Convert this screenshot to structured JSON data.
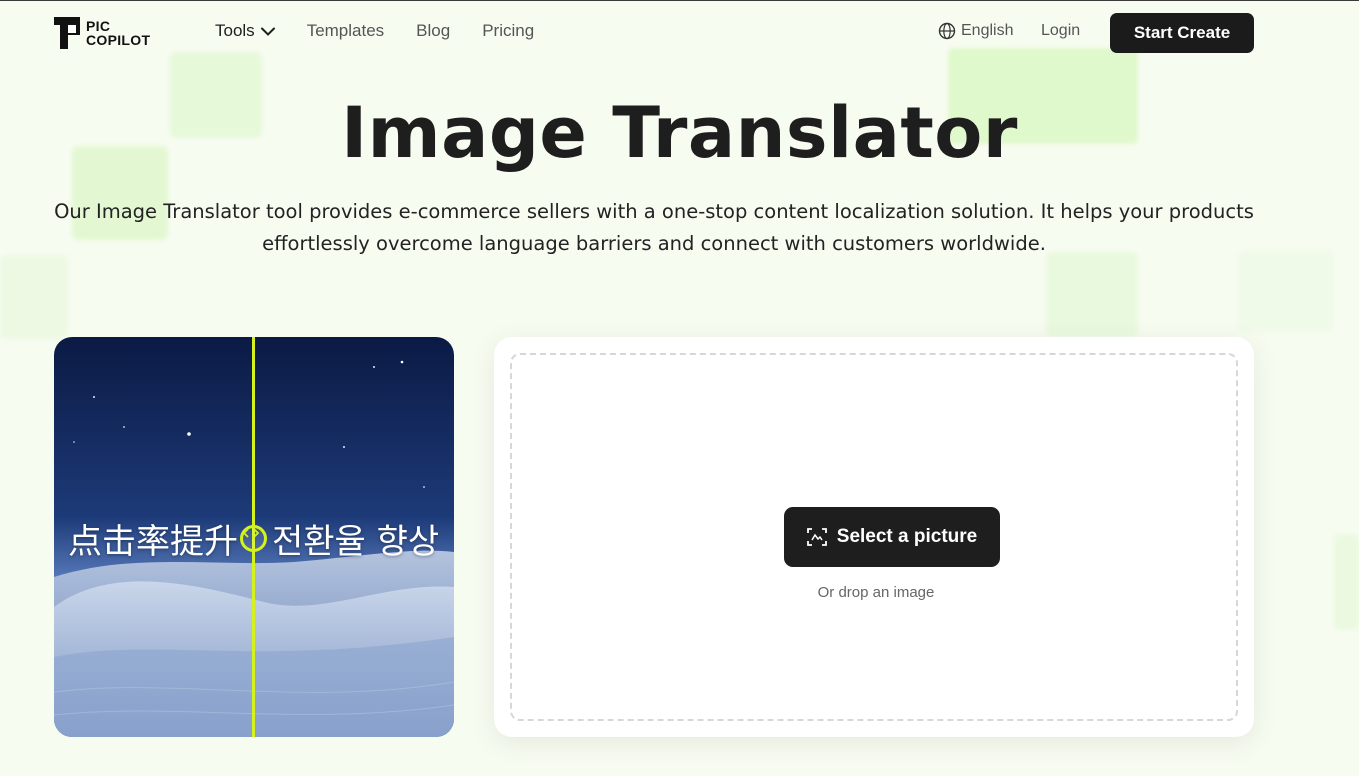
{
  "header": {
    "logo": {
      "line1": "PIC",
      "line2": "COPILOT"
    },
    "nav": [
      {
        "label": "Tools",
        "has_dropdown": true
      },
      {
        "label": "Templates"
      },
      {
        "label": "Blog"
      },
      {
        "label": "Pricing"
      }
    ],
    "language": "English",
    "login": "Login",
    "start_button": "Start Create"
  },
  "hero": {
    "title": "Image Translator",
    "subtitle": "Our Image Translator tool provides e-commerce sellers with a one-stop content localization solution. It helps your products effortlessly overcome language barriers and connect with customers worldwide."
  },
  "preview": {
    "original_text": "点击率提升",
    "translated_text": "전환율 향상"
  },
  "upload": {
    "button_label": "Select a picture",
    "drop_hint": "Or drop an image"
  },
  "colors": {
    "accent": "#d6f21d",
    "button_dark": "#1b1b1b",
    "background": "#f7fcf1"
  }
}
